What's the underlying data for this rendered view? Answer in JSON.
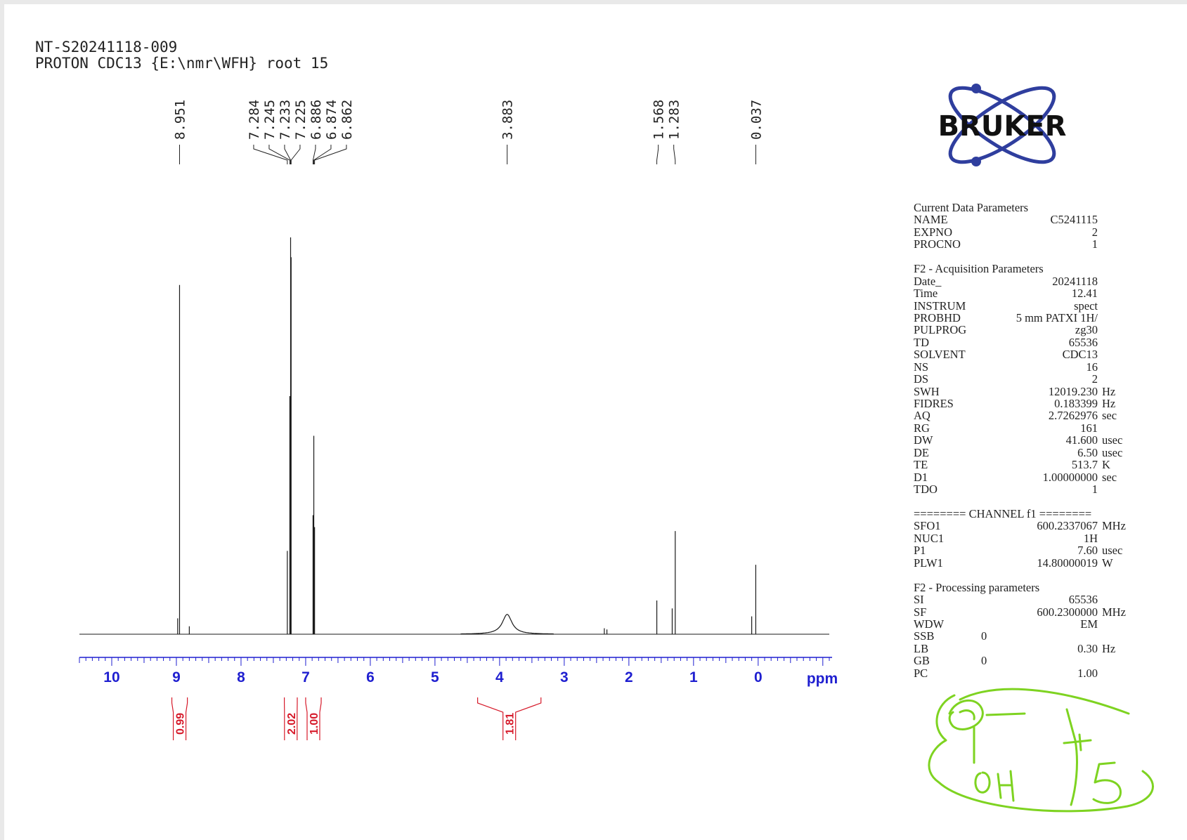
{
  "header": {
    "sample_id": "NT-S20241118-009",
    "experiment": "PROTON CDC13 {E:\\nmr\\WFH} root 15"
  },
  "logo": {
    "text": "BRUKER"
  },
  "colors": {
    "trace": "#1a1a1a",
    "axis": "#1f1fd0",
    "integral": "#d61a2a",
    "annotation": "#7ed321",
    "logo": "#2f3e9e"
  },
  "chart_data": {
    "type": "line",
    "title": "",
    "xlabel": "ppm",
    "ylabel": "",
    "xlim": [
      10.5,
      -1.1
    ],
    "x_reversed": true,
    "x_ticks": [
      "10",
      "9",
      "8",
      "7",
      "6",
      "5",
      "4",
      "3",
      "2",
      "1",
      "0"
    ],
    "x_tick_values": [
      10,
      9,
      8,
      7,
      6,
      5,
      4,
      3,
      2,
      1,
      0
    ],
    "peak_labels": [
      "8.951",
      "7.284",
      "7.245",
      "7.233",
      "7.225",
      "6.886",
      "6.874",
      "6.862",
      "3.883",
      "1.568",
      "1.283",
      "0.037"
    ],
    "peaks": [
      {
        "ppm": 8.951,
        "intensity": 0.88
      },
      {
        "ppm": 8.98,
        "intensity": 0.04
      },
      {
        "ppm": 8.8,
        "intensity": 0.02
      },
      {
        "ppm": 7.284,
        "intensity": 0.21
      },
      {
        "ppm": 7.245,
        "intensity": 0.6
      },
      {
        "ppm": 7.233,
        "intensity": 1.0
      },
      {
        "ppm": 7.225,
        "intensity": 0.95
      },
      {
        "ppm": 6.886,
        "intensity": 0.3
      },
      {
        "ppm": 6.874,
        "intensity": 0.5
      },
      {
        "ppm": 6.862,
        "intensity": 0.27
      },
      {
        "ppm": 2.38,
        "intensity": 0.015
      },
      {
        "ppm": 2.34,
        "intensity": 0.012
      },
      {
        "ppm": 1.568,
        "intensity": 0.085
      },
      {
        "ppm": 1.33,
        "intensity": 0.065
      },
      {
        "ppm": 1.283,
        "intensity": 0.26
      },
      {
        "ppm": 0.1,
        "intensity": 0.045
      },
      {
        "ppm": 0.037,
        "intensity": 0.175
      }
    ],
    "broad_peaks": [
      {
        "ppm": 3.883,
        "intensity": 0.05,
        "width": 0.18
      }
    ],
    "integrals": [
      {
        "from": 9.07,
        "to": 8.83,
        "value": "0.99"
      },
      {
        "from": 7.33,
        "to": 7.13,
        "value": "2.02"
      },
      {
        "from": 7.0,
        "to": 6.76,
        "value": "1.00"
      },
      {
        "from": 4.34,
        "to": 3.36,
        "value": "1.81"
      }
    ]
  },
  "params": {
    "sections": [
      {
        "title": "Current Data Parameters",
        "rows": [
          {
            "name": "NAME",
            "value": "C5241115",
            "unit": ""
          },
          {
            "name": "EXPNO",
            "value": "2",
            "unit": ""
          },
          {
            "name": "PROCNO",
            "value": "1",
            "unit": ""
          }
        ]
      },
      {
        "title": "F2 - Acquisition Parameters",
        "rows": [
          {
            "name": "Date_",
            "value": "20241118",
            "unit": ""
          },
          {
            "name": "Time",
            "value": "12.41",
            "unit": ""
          },
          {
            "name": "INSTRUM",
            "value": "spect",
            "unit": ""
          },
          {
            "name": "PROBHD",
            "value": "5 mm PATXI 1H/",
            "unit": ""
          },
          {
            "name": "PULPROG",
            "value": "zg30",
            "unit": ""
          },
          {
            "name": "TD",
            "value": "65536",
            "unit": ""
          },
          {
            "name": "SOLVENT",
            "value": "CDC13",
            "unit": ""
          },
          {
            "name": "NS",
            "value": "16",
            "unit": ""
          },
          {
            "name": "DS",
            "value": "2",
            "unit": ""
          },
          {
            "name": "SWH",
            "value": "12019.230",
            "unit": "Hz"
          },
          {
            "name": "FIDRES",
            "value": "0.183399",
            "unit": "Hz"
          },
          {
            "name": "AQ",
            "value": "2.7262976",
            "unit": "sec"
          },
          {
            "name": "RG",
            "value": "161",
            "unit": ""
          },
          {
            "name": "DW",
            "value": "41.600",
            "unit": "usec"
          },
          {
            "name": "DE",
            "value": "6.50",
            "unit": "usec"
          },
          {
            "name": "TE",
            "value": "513.7",
            "unit": "K"
          },
          {
            "name": "D1",
            "value": "1.00000000",
            "unit": "sec"
          },
          {
            "name": "TDO",
            "value": "1",
            "unit": ""
          }
        ]
      },
      {
        "title": "======== CHANNEL f1 ========",
        "rows": [
          {
            "name": "SFO1",
            "value": "600.2337067",
            "unit": "MHz"
          },
          {
            "name": "NUC1",
            "value": "1H",
            "unit": ""
          },
          {
            "name": "P1",
            "value": "7.60",
            "unit": "usec"
          },
          {
            "name": "PLW1",
            "value": "14.80000019",
            "unit": "W"
          }
        ]
      },
      {
        "title": "F2 - Processing parameters",
        "rows": [
          {
            "name": "SI",
            "value": "65536",
            "unit": ""
          },
          {
            "name": "SF",
            "value": "600.2300000",
            "unit": "MHz"
          },
          {
            "name": "WDW",
            "value": "EM",
            "unit": ""
          },
          {
            "name": "SSB",
            "value": "",
            "unit": "",
            "sep": "0"
          },
          {
            "name": "LB",
            "value": "0.30",
            "unit": "Hz"
          },
          {
            "name": "GB",
            "value": "",
            "unit": "",
            "sep": "0"
          },
          {
            "name": "PC",
            "value": "1.00",
            "unit": ""
          }
        ]
      }
    ]
  }
}
